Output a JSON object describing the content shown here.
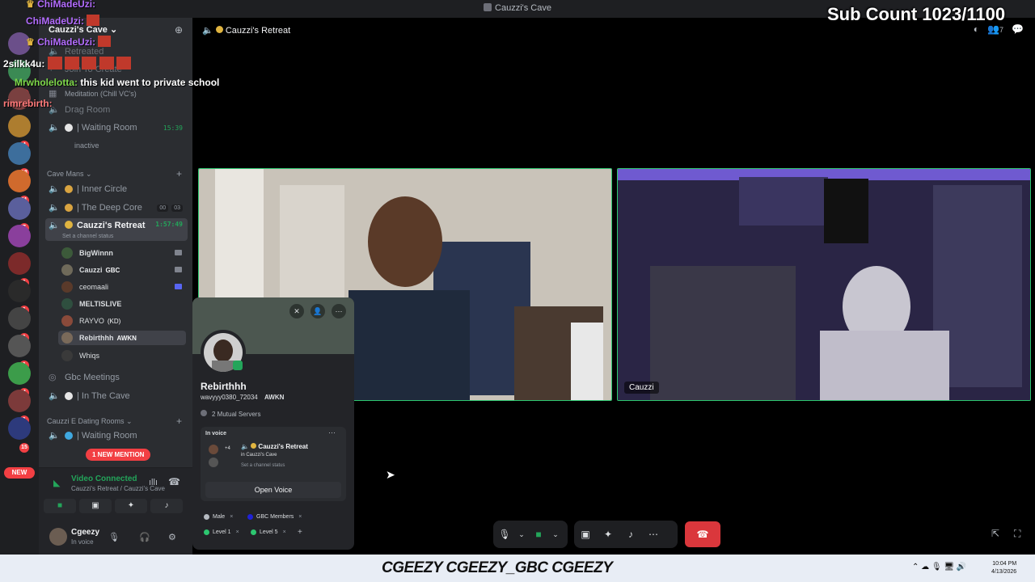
{
  "window": {
    "title": "Cauzzi's Cave"
  },
  "overlay": {
    "sub_count": "Sub Count 1023/1100",
    "chat": [
      {
        "user": "ChiMadeUzi:",
        "text": "",
        "color": "#b36cff"
      },
      {
        "user": "ChiMadeUzi:",
        "text": "",
        "color": "#b36cff"
      },
      {
        "user": "2silkk4u:",
        "text": "",
        "color": "#ffffff"
      },
      {
        "user": "Mrwholelotta:",
        "text": "this kid went to private school",
        "color": "#7fd94a"
      },
      {
        "user": "rimrebirth:",
        "text": "",
        "color": "#ff7a7a"
      }
    ]
  },
  "sidebar": {
    "server_name": "Cauzzi's Cave",
    "top_channels": [
      {
        "label": "Retreated"
      },
      {
        "label": "Join To Create"
      },
      {
        "label": "Meditation (Chill VC's)"
      },
      {
        "label": "Drag Room"
      },
      {
        "label": "| Waiting Room",
        "timer": "15:39"
      },
      {
        "label": "inactive"
      }
    ],
    "category_cave_mans": "Cave Mans",
    "cave_channels": [
      {
        "label": "| Inner Circle"
      },
      {
        "label": "| The Deep Core",
        "c1": "00",
        "c2": "03"
      },
      {
        "label": "Cauzzi's Retreat",
        "timer": "1:57:49",
        "status": "Set a channel status"
      }
    ],
    "members": [
      {
        "name": "BigWinnn"
      },
      {
        "name": "Cauzzi",
        "tag": "GBC"
      },
      {
        "name": "ceomaali"
      },
      {
        "name": "MELTISLIVE"
      },
      {
        "name": "RAYVO",
        "tag": "(KD)"
      },
      {
        "name": "Rebirthhh",
        "tag": "AWKN"
      },
      {
        "name": "Whiqs"
      }
    ],
    "gbc_meetings": "Gbc Meetings",
    "in_the_cave": "| In The Cave",
    "category_dating": "Cauzzi E Dating Rooms",
    "dating_waiting": "| Waiting Room",
    "new_mention": "1 NEW MENTION",
    "new_badge": "NEW"
  },
  "voice_panel": {
    "title": "Video Connected",
    "subtitle": "Cauzzi's Retreat / Cauzzi's Cave"
  },
  "user_panel": {
    "name": "Cgeezy",
    "status": "In voice"
  },
  "main": {
    "channel_title": "Cauzzi's Retreat",
    "member_count": "7",
    "tiles": [
      {
        "name": ""
      },
      {
        "name": "Cauzzi"
      }
    ]
  },
  "profile": {
    "name": "Rebirthhh",
    "handle": "wavyyy0380_72034",
    "tag": "AWKN",
    "mutual": "2 Mutual Servers",
    "in_voice_label": "In voice",
    "voice_channel": "Cauzzi's Retreat",
    "voice_server": "in Cauzzi's Cave",
    "voice_count": "+4",
    "voice_status": "Set a channel status",
    "open_voice": "Open Voice",
    "roles": [
      {
        "name": "Male",
        "color": "#b5bac1"
      },
      {
        "name": "GBC Members",
        "color": "#1f22d6"
      },
      {
        "name": "Level 1",
        "color": "#2dc770"
      },
      {
        "name": "Level 5",
        "color": "#2dc770"
      }
    ]
  },
  "taskbar": {
    "handles": "CGEEZY  CGEEZY_GBC  CGEEZY",
    "time": "10:04 PM",
    "date": "4/13/2026"
  }
}
